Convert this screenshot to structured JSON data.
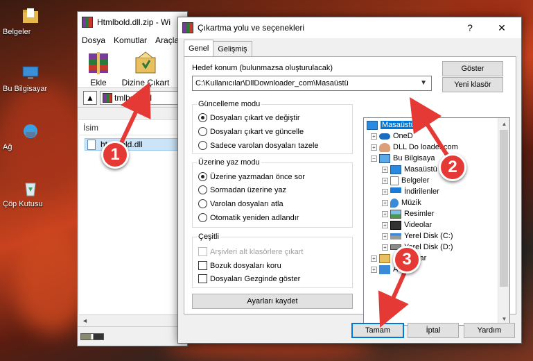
{
  "desktop": {
    "icons": [
      {
        "label": "Belgeler",
        "icon": "folder-documents-icon"
      },
      {
        "label": "Bu Bilgisayar",
        "icon": "computer-icon"
      },
      {
        "label": "Ağ",
        "icon": "network-icon"
      },
      {
        "label": "Çöp Kutusu",
        "icon": "recycle-bin-icon"
      }
    ]
  },
  "winrar": {
    "title": "Htmlbold.dll.zip - Wi",
    "menu": [
      "Dosya",
      "Komutlar",
      "Araçla"
    ],
    "tools": [
      "Ekle",
      "Dizine Çıkart"
    ],
    "path": "tmlbold.dll",
    "column_name": "İsim",
    "file": "htmlbold.dll",
    "scroll_left": "◄"
  },
  "dialog": {
    "title": "Çıkartma yolu ve seçenekleri",
    "help": "?",
    "close": "✕",
    "tabs": [
      "Genel",
      "Gelişmiş"
    ],
    "dest_label": "Hedef konum (bulunmazsa oluşturulacak)",
    "dest_value": "C:\\Kullanıcılar\\DllDownloader_com\\Masaüstü",
    "show_button": "Göster",
    "new_folder_button": "Yeni klasör",
    "update_group": {
      "title": "Güncelleme modu",
      "options": [
        "Dosyaları çıkart ve değiştir",
        "Dosyaları çıkart ve güncelle",
        "Sadece varolan dosyaları tazele"
      ]
    },
    "overwrite_group": {
      "title": "Üzerine yaz modu",
      "options": [
        "Üzerine yazmadan önce sor",
        "Sormadan üzerine yaz",
        "Varolan dosyaları atla",
        "Otomatik yeniden adlandır"
      ]
    },
    "misc_group": {
      "title": "Çeşitli",
      "options": [
        "Arşivleri alt klasörlere çıkart",
        "Bozuk dosyaları koru",
        "Dosyaları Gezginde göster"
      ]
    },
    "save_settings": "Ayarları kaydet",
    "tree": {
      "items": [
        {
          "label": "Masaüstü",
          "icon": "desktop-icon"
        },
        {
          "label": "OneD",
          "icon": "onedrive-icon"
        },
        {
          "label": "DLL Do   loader.com",
          "icon": "user-icon"
        },
        {
          "label": "Bu Bilgisaya",
          "icon": "computer-icon"
        },
        {
          "label": "Masaüstü",
          "icon": "desktop-icon"
        },
        {
          "label": "Belgeler",
          "icon": "documents-icon"
        },
        {
          "label": "İndirilenler",
          "icon": "downloads-icon"
        },
        {
          "label": "Müzik",
          "icon": "music-icon"
        },
        {
          "label": "Resimler",
          "icon": "pictures-icon"
        },
        {
          "label": "Videolar",
          "icon": "videos-icon"
        },
        {
          "label": "Yerel Disk (C:)",
          "icon": "disk-icon"
        },
        {
          "label": "Yerel Disk (D:)",
          "icon": "disk-icon"
        },
        {
          "label": "Kitaplıklar",
          "icon": "libraries-icon"
        },
        {
          "label": "A",
          "icon": "network-icon"
        }
      ],
      "expand_glyph": "+",
      "collapse_glyph": "−",
      "scroll_up": "▲",
      "scroll_down": "▼"
    },
    "ok_button": "Tamam",
    "cancel_button": "İptal",
    "help_button": "Yardım"
  },
  "annotations": [
    "1",
    "2",
    "3"
  ],
  "colors": {
    "accent": "#0078d7",
    "badge": "#e53935"
  }
}
